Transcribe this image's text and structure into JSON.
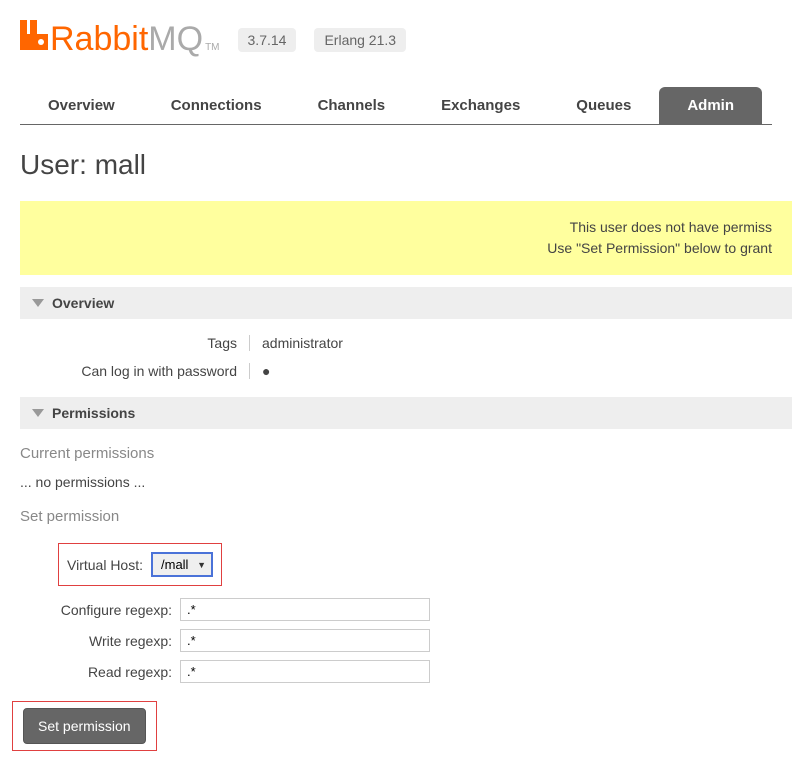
{
  "header": {
    "logo": {
      "rabbit": "Rabbit",
      "mq": "MQ",
      "tm": "TM"
    },
    "version": "3.7.14",
    "erlang": "Erlang 21.3"
  },
  "tabs": [
    {
      "label": "Overview",
      "active": false
    },
    {
      "label": "Connections",
      "active": false
    },
    {
      "label": "Channels",
      "active": false
    },
    {
      "label": "Exchanges",
      "active": false
    },
    {
      "label": "Queues",
      "active": false
    },
    {
      "label": "Admin",
      "active": true
    }
  ],
  "page": {
    "title_prefix": "User: ",
    "title_user": "mall"
  },
  "warning": {
    "line1": "This user does not have permiss",
    "line2": "Use \"Set Permission\" below to grant"
  },
  "sections": {
    "overview": {
      "title": "Overview",
      "rows": [
        {
          "label": "Tags",
          "value": "administrator"
        },
        {
          "label": "Can log in with password",
          "value": "●"
        }
      ]
    },
    "permissions": {
      "title": "Permissions",
      "current_label": "Current permissions",
      "no_permissions": "... no permissions ...",
      "set_label": "Set permission",
      "form": {
        "virtual_host": {
          "label": "Virtual Host:",
          "value": "/mall"
        },
        "configure": {
          "label": "Configure regexp:",
          "value": ".*"
        },
        "write": {
          "label": "Write regexp:",
          "value": ".*"
        },
        "read": {
          "label": "Read regexp:",
          "value": ".*"
        },
        "submit": "Set permission"
      }
    }
  }
}
